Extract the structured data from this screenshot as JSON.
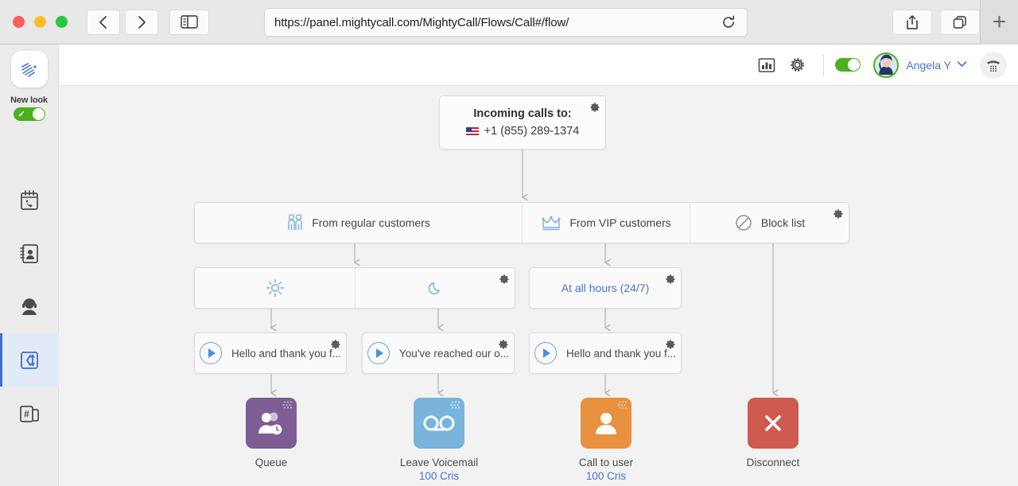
{
  "browser": {
    "url": "https://panel.mightycall.com/MightyCall/Flows/Call#/flow/",
    "back_icon": "chevron-left-icon",
    "forward_icon": "chevron-right-icon",
    "sidebar_icon": "sidebar-toggle-icon",
    "reload_icon": "reload-icon",
    "share_icon": "share-icon",
    "tabs_icon": "tabs-overview-icon",
    "new_tab_label": "+"
  },
  "sidebar": {
    "logo_name": "mightycall-logo",
    "new_look": {
      "label": "New look",
      "enabled": true
    },
    "items": [
      {
        "name": "sidebar-item-calls",
        "icon": "phone-calendar-icon",
        "active": false
      },
      {
        "name": "sidebar-item-contacts",
        "icon": "contacts-book-icon",
        "active": false
      },
      {
        "name": "sidebar-item-agents",
        "icon": "agent-headset-icon",
        "active": false
      },
      {
        "name": "sidebar-item-call-flows",
        "icon": "call-flow-icon",
        "active": true
      },
      {
        "name": "sidebar-item-numbers",
        "icon": "numbers-devices-icon",
        "active": false
      }
    ]
  },
  "header": {
    "stats_icon": "bar-chart-icon",
    "settings_icon": "gear-icon",
    "availability_toggle": true,
    "user_name": "Angela Y",
    "caret_icon": "chevron-down-icon",
    "dialpad_icon": "dialpad-handset-icon"
  },
  "flow": {
    "root": {
      "title": "Incoming calls to:",
      "number": "+1 (855) 289-1374",
      "flag": "us-flag-icon",
      "gear_icon": "gear-icon"
    },
    "customer_segments": [
      {
        "label": "From regular customers",
        "icon": "two-people-icon"
      },
      {
        "label": "From VIP customers",
        "icon": "crown-icon"
      },
      {
        "label": "Block list",
        "icon": "block-circle-icon"
      }
    ],
    "schedule_segments": [
      {
        "label": "",
        "icon": "sun-icon"
      },
      {
        "label": "",
        "icon": "moon-icon"
      }
    ],
    "all_hours": {
      "label": "At all hours (24/7)",
      "gear_icon": "gear-icon"
    },
    "greetings": [
      {
        "label": "Hello and thank you f...",
        "icon": "play-icon",
        "gear_icon": "gear-icon"
      },
      {
        "label": "You've reached our o...",
        "icon": "play-icon",
        "gear_icon": "gear-icon"
      },
      {
        "label": "Hello and thank you f...",
        "icon": "play-icon",
        "gear_icon": "gear-icon"
      }
    ],
    "actions": [
      {
        "label": "Queue",
        "sub": "",
        "icon": "queue-icon",
        "color": "#7d5d94"
      },
      {
        "label": "Leave Voicemail",
        "sub": "100 Cris",
        "icon": "voicemail-icon",
        "color": "#79b4dd"
      },
      {
        "label": "Call to user",
        "sub": "100 Cris",
        "icon": "user-icon",
        "color": "#e8913f"
      },
      {
        "label": "Disconnect",
        "sub": "",
        "icon": "close-x-icon",
        "color": "#cf5a50"
      }
    ]
  },
  "colors": {
    "accent_blue": "#4a74c9",
    "toggle_green": "#4caf1e",
    "canvas": "#f2f2f2"
  }
}
